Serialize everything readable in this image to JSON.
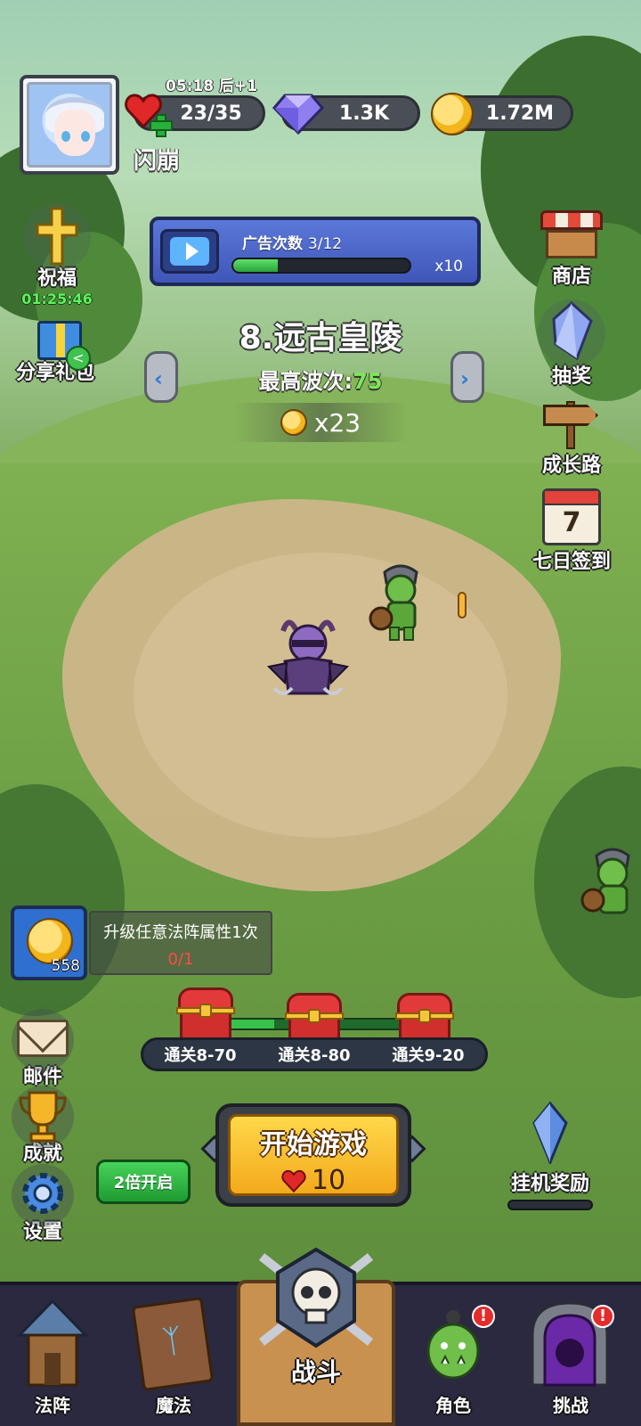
{
  "player": {
    "name": "闪崩",
    "timer": "05:18",
    "timer_suffix": "后+1"
  },
  "resources": {
    "stamina": "23/35",
    "gems": "1.3K",
    "gold": "1.72M"
  },
  "left_menu": {
    "blessing_label": "祝福",
    "blessing_timer": "01:25:46",
    "share_label": "分享礼包"
  },
  "right_menu": {
    "shop": "商店",
    "lottery": "抽奖",
    "growth": "成长路",
    "checkin": "七日签到",
    "checkin_day": "7"
  },
  "ad_banner": {
    "title": "广告次数",
    "count": "3/12",
    "progress": 0.25,
    "multiplier": "x10"
  },
  "stage": {
    "name": "8.远古皇陵",
    "best_wave_label": "最高波次:",
    "best_wave_value": "75",
    "reward": "x23"
  },
  "quest": {
    "icon_count": "558",
    "text": "升级任意法阵属性1次",
    "progress": "0/1"
  },
  "chests": {
    "progress": 0.3,
    "items": [
      "通关8-70",
      "通关8-80",
      "通关9-20"
    ]
  },
  "utility": {
    "mail": "邮件",
    "achievement": "成就",
    "settings": "设置"
  },
  "double_button": "2倍开启",
  "start": {
    "label": "开始游戏",
    "cost": "10"
  },
  "idle_reward": "挂机奖励",
  "bottom_nav": {
    "formation": "法阵",
    "magic": "魔法",
    "magic_rune": "ᛉ",
    "battle": "战斗",
    "character": "角色",
    "challenge": "挑战",
    "badge": "!"
  },
  "colors": {
    "accent_green": "#7de85a",
    "alert_red": "#e52b2b",
    "gold": "#f4a91c"
  }
}
